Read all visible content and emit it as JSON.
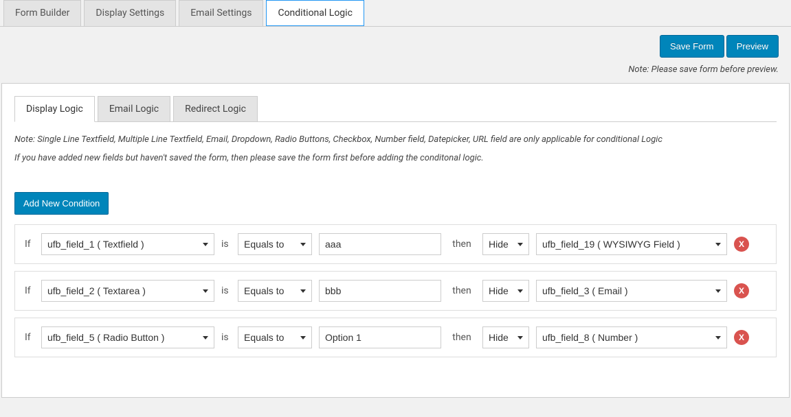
{
  "topTabs": [
    {
      "label": "Form Builder",
      "active": false
    },
    {
      "label": "Display Settings",
      "active": false
    },
    {
      "label": "Email Settings",
      "active": false
    },
    {
      "label": "Conditional Logic",
      "active": true
    }
  ],
  "actions": {
    "saveForm": "Save Form",
    "preview": "Preview"
  },
  "topNote": "Note: Please save form before preview.",
  "innerTabs": [
    {
      "label": "Display Logic",
      "active": true
    },
    {
      "label": "Email Logic",
      "active": false
    },
    {
      "label": "Redirect Logic",
      "active": false
    }
  ],
  "infoNote1": "Note: Single Line Textfield, Multiple Line Textfield, Email, Dropdown, Radio Buttons, Checkbox, Number field, Datepicker, URL field are only applicable for conditional Logic",
  "infoNote2": "If you have added new fields but haven't saved the form, then please save the form first before adding the conditonal logic.",
  "addButton": "Add New Condition",
  "labels": {
    "if": "If",
    "is": "is",
    "then": "then"
  },
  "conditions": [
    {
      "field": "ufb_field_1 ( Textfield )",
      "operator": "Equals to",
      "value": "aaa",
      "action": "Hide",
      "target": "ufb_field_19 ( WYSIWYG Field )"
    },
    {
      "field": "ufb_field_2 ( Textarea )",
      "operator": "Equals to",
      "value": "bbb",
      "action": "Hide",
      "target": "ufb_field_3 ( Email )"
    },
    {
      "field": "ufb_field_5 ( Radio Button )",
      "operator": "Equals to",
      "value": "Option 1",
      "action": "Hide",
      "target": "ufb_field_8 ( Number )"
    }
  ],
  "removeLabel": "X",
  "colors": {
    "primary": "#0085ba",
    "danger": "#d9534f"
  }
}
